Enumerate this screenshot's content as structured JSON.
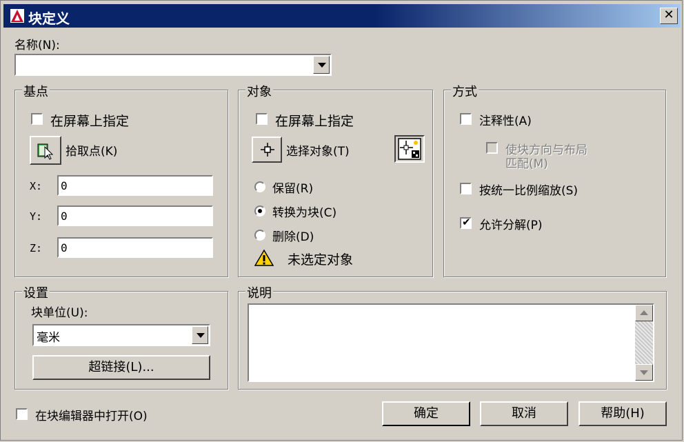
{
  "window": {
    "title": "块定义",
    "close_label": "✕"
  },
  "name": {
    "label": "名称(N):",
    "value": ""
  },
  "base_point": {
    "title": "基点",
    "specify_on_screen": "在屏幕上指定",
    "pick_point": "拾取点(K)",
    "x_label": "X:",
    "y_label": "Y:",
    "z_label": "Z:",
    "x": "0",
    "y": "0",
    "z": "0"
  },
  "objects": {
    "title": "对象",
    "specify_on_screen": "在屏幕上指定",
    "select_objects": "选择对象(T)",
    "retain": "保留(R)",
    "convert_to_block": "转换为块(C)",
    "delete": "删除(D)",
    "warning": "未选定对象",
    "selected_option": "convert_to_block"
  },
  "behavior": {
    "title": "方式",
    "annotative": "注释性(A)",
    "match_orientation_line1": "使块方向与布局",
    "match_orientation_line2": "匹配(M)",
    "scale_uniformly": "按统一比例缩放(S)",
    "allow_exploding": "允许分解(P)",
    "annotative_checked": false,
    "scale_uniformly_checked": false,
    "allow_exploding_checked": true
  },
  "settings": {
    "title": "设置",
    "block_unit_label": "块单位(U):",
    "block_unit_value": "毫米",
    "hyperlink_button": "超链接(L)..."
  },
  "description": {
    "title": "说明",
    "value": ""
  },
  "footer": {
    "open_in_editor": "在块编辑器中打开(O)",
    "ok": "确定",
    "cancel": "取消",
    "help": "帮助(H)"
  },
  "icons": {
    "app": "autocad-logo-icon",
    "pick_point": "pick-point-icon",
    "select_objects": "select-objects-icon",
    "quick_select": "quick-select-icon",
    "warning": "warning-icon"
  },
  "colors": {
    "titlebar": "#0a246a",
    "face": "#d4d0c8",
    "warning": "#ffd200"
  }
}
